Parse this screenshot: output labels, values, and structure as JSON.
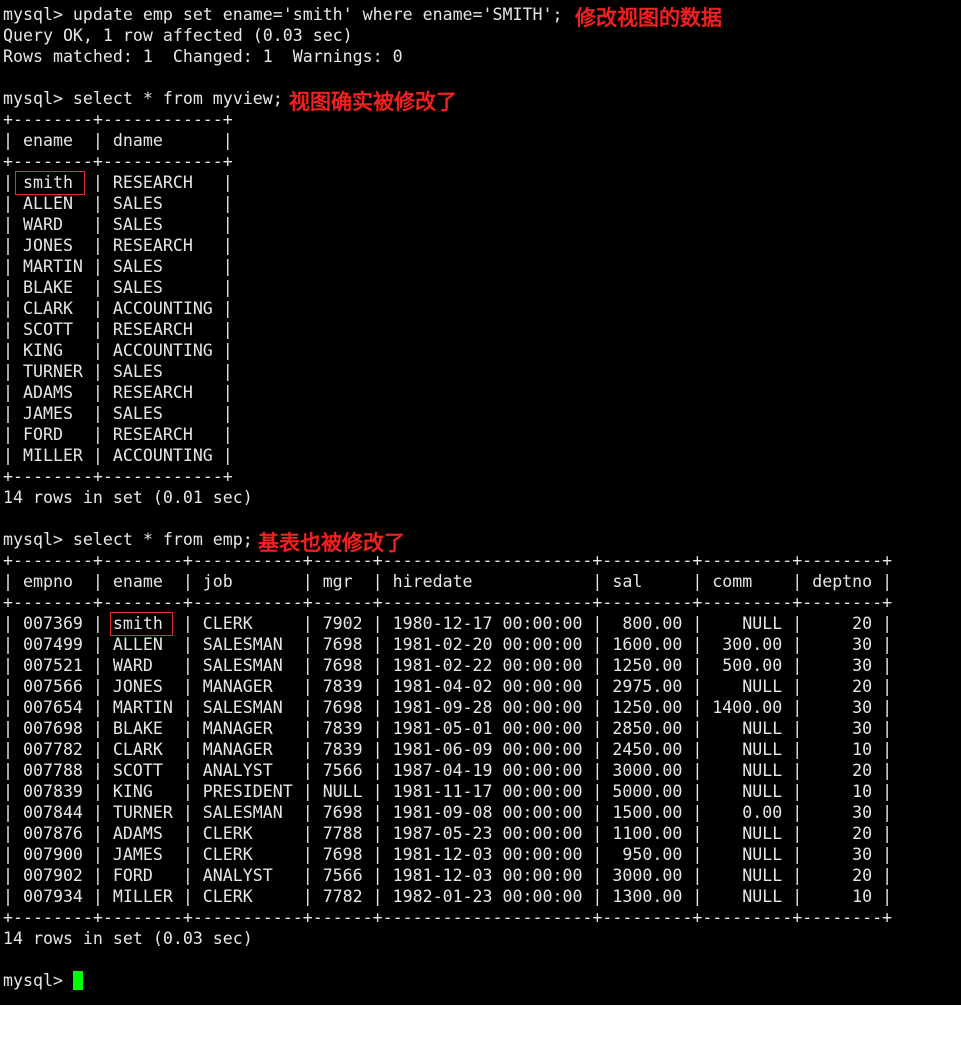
{
  "terminal": {
    "prompt": "mysql> ",
    "cursor_color": "#00ff00",
    "annotation_color": "#f02020",
    "blocks": {
      "update_cmd": "mysql> update emp set ename='smith' where ename='SMITH';",
      "update_result_1": "Query OK, 1 row affected (0.03 sec)",
      "update_result_2": "Rows matched: 1  Changed: 1  Warnings: 0",
      "view_cmd": "mysql> select * from myview;",
      "view_footer": "14 rows in set (0.01 sec)",
      "emp_cmd": "mysql> select * from emp;",
      "emp_footer": "14 rows in set (0.03 sec)",
      "final_prompt": "mysql> "
    },
    "annotations": {
      "update": "修改视图的数据",
      "view": "视图确实被修改了",
      "emp": "基表也被修改了"
    }
  },
  "view_table": {
    "border": "+--------+------------+",
    "header_row": "| ename  | dname      |",
    "columns": [
      "ename",
      "dname"
    ],
    "rows": [
      [
        "smith",
        "RESEARCH"
      ],
      [
        "ALLEN",
        "SALES"
      ],
      [
        "WARD",
        "SALES"
      ],
      [
        "JONES",
        "RESEARCH"
      ],
      [
        "MARTIN",
        "SALES"
      ],
      [
        "BLAKE",
        "SALES"
      ],
      [
        "CLARK",
        "ACCOUNTING"
      ],
      [
        "SCOTT",
        "RESEARCH"
      ],
      [
        "KING",
        "ACCOUNTING"
      ],
      [
        "TURNER",
        "SALES"
      ],
      [
        "ADAMS",
        "RESEARCH"
      ],
      [
        "JAMES",
        "SALES"
      ],
      [
        "FORD",
        "RESEARCH"
      ],
      [
        "MILLER",
        "ACCOUNTING"
      ]
    ],
    "lines": [
      "| smith  | RESEARCH   |",
      "| ALLEN  | SALES      |",
      "| WARD   | SALES      |",
      "| JONES  | RESEARCH   |",
      "| MARTIN | SALES      |",
      "| BLAKE  | SALES      |",
      "| CLARK  | ACCOUNTING |",
      "| SCOTT  | RESEARCH   |",
      "| KING   | ACCOUNTING |",
      "| TURNER | SALES      |",
      "| ADAMS  | RESEARCH   |",
      "| JAMES  | SALES      |",
      "| FORD   | RESEARCH   |",
      "| MILLER | ACCOUNTING |"
    ]
  },
  "emp_table": {
    "border": "+--------+--------+-----------+------+---------------------+---------+---------+--------+",
    "header_row": "| empno  | ename  | job       | mgr  | hiredate            | sal     | comm    | deptno |",
    "columns": [
      "empno",
      "ename",
      "job",
      "mgr",
      "hiredate",
      "sal",
      "comm",
      "deptno"
    ],
    "rows": [
      [
        "007369",
        "smith",
        "CLERK",
        "7902",
        "1980-12-17 00:00:00",
        "800.00",
        "NULL",
        "20"
      ],
      [
        "007499",
        "ALLEN",
        "SALESMAN",
        "7698",
        "1981-02-20 00:00:00",
        "1600.00",
        "300.00",
        "30"
      ],
      [
        "007521",
        "WARD",
        "SALESMAN",
        "7698",
        "1981-02-22 00:00:00",
        "1250.00",
        "500.00",
        "30"
      ],
      [
        "007566",
        "JONES",
        "MANAGER",
        "7839",
        "1981-04-02 00:00:00",
        "2975.00",
        "NULL",
        "20"
      ],
      [
        "007654",
        "MARTIN",
        "SALESMAN",
        "7698",
        "1981-09-28 00:00:00",
        "1250.00",
        "1400.00",
        "30"
      ],
      [
        "007698",
        "BLAKE",
        "MANAGER",
        "7839",
        "1981-05-01 00:00:00",
        "2850.00",
        "NULL",
        "30"
      ],
      [
        "007782",
        "CLARK",
        "MANAGER",
        "7839",
        "1981-06-09 00:00:00",
        "2450.00",
        "NULL",
        "10"
      ],
      [
        "007788",
        "SCOTT",
        "ANALYST",
        "7566",
        "1987-04-19 00:00:00",
        "3000.00",
        "NULL",
        "20"
      ],
      [
        "007839",
        "KING",
        "PRESIDENT",
        "NULL",
        "1981-11-17 00:00:00",
        "5000.00",
        "NULL",
        "10"
      ],
      [
        "007844",
        "TURNER",
        "SALESMAN",
        "7698",
        "1981-09-08 00:00:00",
        "1500.00",
        "0.00",
        "30"
      ],
      [
        "007876",
        "ADAMS",
        "CLERK",
        "7788",
        "1987-05-23 00:00:00",
        "1100.00",
        "NULL",
        "20"
      ],
      [
        "007900",
        "JAMES",
        "CLERK",
        "7698",
        "1981-12-03 00:00:00",
        "950.00",
        "NULL",
        "30"
      ],
      [
        "007902",
        "FORD",
        "ANALYST",
        "7566",
        "1981-12-03 00:00:00",
        "3000.00",
        "NULL",
        "20"
      ],
      [
        "007934",
        "MILLER",
        "CLERK",
        "7782",
        "1982-01-23 00:00:00",
        "1300.00",
        "NULL",
        "10"
      ]
    ],
    "lines": [
      "| 007369 | smith  | CLERK     | 7902 | 1980-12-17 00:00:00 |  800.00 |    NULL |     20 |",
      "| 007499 | ALLEN  | SALESMAN  | 7698 | 1981-02-20 00:00:00 | 1600.00 |  300.00 |     30 |",
      "| 007521 | WARD   | SALESMAN  | 7698 | 1981-02-22 00:00:00 | 1250.00 |  500.00 |     30 |",
      "| 007566 | JONES  | MANAGER   | 7839 | 1981-04-02 00:00:00 | 2975.00 |    NULL |     20 |",
      "| 007654 | MARTIN | SALESMAN  | 7698 | 1981-09-28 00:00:00 | 1250.00 | 1400.00 |     30 |",
      "| 007698 | BLAKE  | MANAGER   | 7839 | 1981-05-01 00:00:00 | 2850.00 |    NULL |     30 |",
      "| 007782 | CLARK  | MANAGER   | 7839 | 1981-06-09 00:00:00 | 2450.00 |    NULL |     10 |",
      "| 007788 | SCOTT  | ANALYST   | 7566 | 1987-04-19 00:00:00 | 3000.00 |    NULL |     20 |",
      "| 007839 | KING   | PRESIDENT | NULL | 1981-11-17 00:00:00 | 5000.00 |    NULL |     10 |",
      "| 007844 | TURNER | SALESMAN  | 7698 | 1981-09-08 00:00:00 | 1500.00 |    0.00 |     30 |",
      "| 007876 | ADAMS  | CLERK     | 7788 | 1987-05-23 00:00:00 | 1100.00 |    NULL |     20 |",
      "| 007900 | JAMES  | CLERK     | 7698 | 1981-12-03 00:00:00 |  950.00 |    NULL |     30 |",
      "| 007902 | FORD   | ANALYST   | 7566 | 1981-12-03 00:00:00 | 3000.00 |    NULL |     20 |",
      "| 007934 | MILLER | CLERK     | 7782 | 1982-01-23 00:00:00 | 1300.00 |    NULL |     10 |"
    ]
  }
}
